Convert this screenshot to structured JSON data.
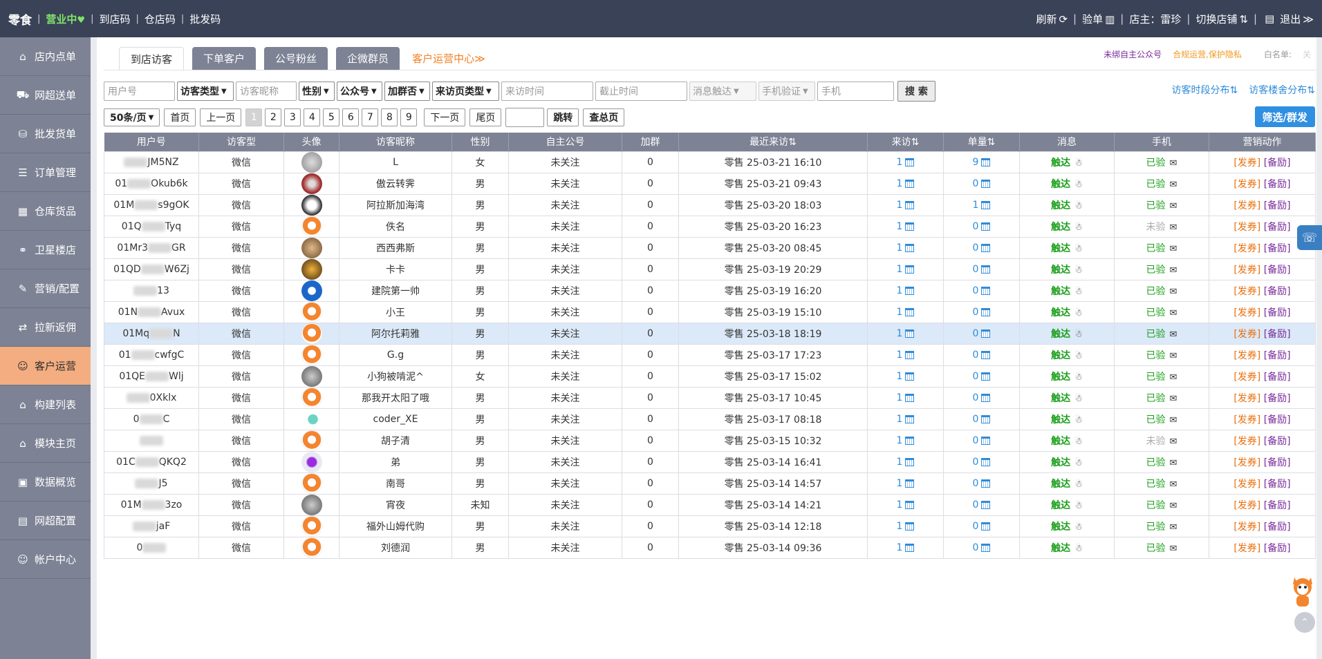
{
  "topbar": {
    "brand": "零食",
    "status": "营业中",
    "links": [
      "到店码",
      "仓店码",
      "批发码"
    ],
    "refresh": "刷新",
    "verify": "验单",
    "owner": "店主：雷珍",
    "switch_store": "切换店铺",
    "logout": "退出"
  },
  "sidebar": {
    "items": [
      {
        "label": "店内点单",
        "icon": "home-icon"
      },
      {
        "label": "网超送单",
        "icon": "delivery-icon"
      },
      {
        "label": "批发货单",
        "icon": "wholesale-icon"
      },
      {
        "label": "订单管理",
        "icon": "order-icon"
      },
      {
        "label": "仓库货品",
        "icon": "warehouse-icon"
      },
      {
        "label": "卫星楼店",
        "icon": "satellite-icon"
      },
      {
        "label": "营销/配置",
        "icon": "marketing-icon"
      },
      {
        "label": "拉新返佣",
        "icon": "commission-icon"
      },
      {
        "label": "客户运营",
        "icon": "customer-icon"
      },
      {
        "label": "构建列表",
        "icon": "build-icon"
      },
      {
        "label": "模块主页",
        "icon": "module-icon"
      },
      {
        "label": "数据概览",
        "icon": "data-icon"
      },
      {
        "label": "网超配置",
        "icon": "config-icon"
      },
      {
        "label": "帐户中心",
        "icon": "account-icon"
      }
    ],
    "active_index": 8
  },
  "tabs": {
    "items": [
      "到店访客",
      "下单客户",
      "公号粉丝",
      "企微群员"
    ],
    "center_link": "客户运营中心≫"
  },
  "notes": {
    "unbound": "未绑自主公众号",
    "compliance": "合规运营,保护隐私",
    "whitelist": "白名单:",
    "whitelist_faint": "关"
  },
  "filters": {
    "user_id_placeholder": "用户号",
    "visitor_type": "访客类型",
    "nickname_placeholder": "访客昵称",
    "gender": "性别",
    "official": "公众号",
    "joined": "加群否",
    "source": "来访页类型",
    "visit_time_placeholder": "来访时间",
    "end_time_placeholder": "截止时间",
    "message_reach": "消息触达",
    "phone_verify": "手机验证",
    "phone_placeholder": "手机",
    "search": "搜 索",
    "dist_time": "访客时段分布⇅",
    "dist_building": "访客楼舍分布⇅"
  },
  "pager": {
    "per_page": "50条/页",
    "first": "首页",
    "prev": "上一页",
    "pages": [
      "1",
      "2",
      "3",
      "4",
      "5",
      "6",
      "7",
      "8",
      "9"
    ],
    "current": "1",
    "next": "下一页",
    "last": "尾页",
    "jump": "跳转",
    "total": "查总页",
    "filter_send": "筛选/群发"
  },
  "table": {
    "headers": [
      "用户号",
      "访客型",
      "头像",
      "访客昵称",
      "性别",
      "自主公号",
      "加群",
      "最近来访⇅",
      "来访⇅",
      "单量⇅",
      "消息",
      "手机",
      "营销动作"
    ],
    "rows": [
      {
        "uid_pre": "",
        "uid_suf": "JM5NZ",
        "type": "微信",
        "avatar": "av-gray",
        "nick": "L",
        "gender": "女",
        "follow": "未关注",
        "group": "0",
        "last": "零售 25-03-21 16:10",
        "visits": "1",
        "orders": "9",
        "msg": "触达",
        "phone": "已验",
        "coupon": "[发券]",
        "reward": "[备励]"
      },
      {
        "uid_pre": "01",
        "uid_suf": "Okub6k",
        "type": "微信",
        "avatar": "av-red",
        "nick": "傲云转霁",
        "gender": "男",
        "follow": "未关注",
        "group": "0",
        "last": "零售 25-03-21 09:43",
        "visits": "1",
        "orders": "0",
        "msg": "触达",
        "phone": "已验",
        "coupon": "[发券]",
        "reward": "[备励]"
      },
      {
        "uid_pre": "01M",
        "uid_suf": "s9gOK",
        "type": "微信",
        "avatar": "av-white",
        "nick": "阿拉斯加海湾",
        "gender": "男",
        "follow": "未关注",
        "group": "0",
        "last": "零售 25-03-20 18:03",
        "visits": "1",
        "orders": "1",
        "msg": "触达",
        "phone": "已验",
        "coupon": "[发券]",
        "reward": "[备励]"
      },
      {
        "uid_pre": "01Q",
        "uid_suf": "Tyq",
        "type": "微信",
        "avatar": "av-fox",
        "nick": "佚名",
        "gender": "男",
        "follow": "未关注",
        "group": "0",
        "last": "零售 25-03-20 16:23",
        "visits": "1",
        "orders": "0",
        "msg": "触达",
        "phone": "未验",
        "coupon": "[发券]",
        "reward": "[备励]"
      },
      {
        "uid_pre": "01Mr3",
        "uid_suf": "GR",
        "type": "微信",
        "avatar": "av-face",
        "nick": "西西弗斯",
        "gender": "男",
        "follow": "未关注",
        "group": "0",
        "last": "零售 25-03-20 08:45",
        "visits": "1",
        "orders": "0",
        "msg": "触达",
        "phone": "已验",
        "coupon": "[发券]",
        "reward": "[备励]"
      },
      {
        "uid_pre": "01QD",
        "uid_suf": "W6Zj",
        "type": "微信",
        "avatar": "av-gold",
        "nick": "卡卡",
        "gender": "男",
        "follow": "未关注",
        "group": "0",
        "last": "零售 25-03-19 20:29",
        "visits": "1",
        "orders": "0",
        "msg": "触达",
        "phone": "已验",
        "coupon": "[发券]",
        "reward": "[备励]"
      },
      {
        "uid_pre": "",
        "uid_suf": "13",
        "type": "微信",
        "avatar": "av-blue",
        "nick": "建院第一帅",
        "gender": "男",
        "follow": "未关注",
        "group": "0",
        "last": "零售 25-03-19 16:20",
        "visits": "1",
        "orders": "0",
        "msg": "触达",
        "phone": "已验",
        "coupon": "[发券]",
        "reward": "[备励]"
      },
      {
        "uid_pre": "01N",
        "uid_suf": "Avux",
        "type": "微信",
        "avatar": "av-fox",
        "nick": "小王",
        "gender": "男",
        "follow": "未关注",
        "group": "0",
        "last": "零售 25-03-19 15:10",
        "visits": "1",
        "orders": "0",
        "msg": "触达",
        "phone": "已验",
        "coupon": "[发券]",
        "reward": "[备励]"
      },
      {
        "uid_pre": "01Mq",
        "uid_suf": "N",
        "type": "微信",
        "avatar": "av-fox",
        "nick": "阿尔托莉雅",
        "gender": "男",
        "follow": "未关注",
        "group": "0",
        "last": "零售 25-03-18 18:19",
        "visits": "1",
        "orders": "0",
        "msg": "触达",
        "phone": "已验",
        "coupon": "[发券]",
        "reward": "[备励]"
      },
      {
        "uid_pre": "01",
        "uid_suf": "cwfgC",
        "type": "微信",
        "avatar": "av-fox",
        "nick": "G.g",
        "gender": "男",
        "follow": "未关注",
        "group": "0",
        "last": "零售 25-03-17 17:23",
        "visits": "1",
        "orders": "0",
        "msg": "触达",
        "phone": "已验",
        "coupon": "[发券]",
        "reward": "[备励]"
      },
      {
        "uid_pre": "01QE",
        "uid_suf": "Wlj",
        "type": "微信",
        "avatar": "av-cat",
        "nick": "小狗被啃泥^",
        "gender": "女",
        "follow": "未关注",
        "group": "0",
        "last": "零售 25-03-17 15:02",
        "visits": "1",
        "orders": "0",
        "msg": "触达",
        "phone": "已验",
        "coupon": "[发券]",
        "reward": "[备励]"
      },
      {
        "uid_pre": "",
        "uid_suf": "0Xklx",
        "type": "微信",
        "avatar": "av-fox",
        "nick": "那我开太阳了哦",
        "gender": "男",
        "follow": "未关注",
        "group": "0",
        "last": "零售 25-03-17 10:45",
        "visits": "1",
        "orders": "0",
        "msg": "触达",
        "phone": "已验",
        "coupon": "[发券]",
        "reward": "[备励]"
      },
      {
        "uid_pre": "0",
        "uid_suf": "C",
        "type": "微信",
        "avatar": "av-teal",
        "nick": "coder_XE",
        "gender": "男",
        "follow": "未关注",
        "group": "0",
        "last": "零售 25-03-17 08:18",
        "visits": "1",
        "orders": "0",
        "msg": "触达",
        "phone": "已验",
        "coupon": "[发券]",
        "reward": "[备励]"
      },
      {
        "uid_pre": "",
        "uid_suf": "",
        "type": "微信",
        "avatar": "av-fox",
        "nick": "胡子清",
        "gender": "男",
        "follow": "未关注",
        "group": "0",
        "last": "零售 25-03-15 10:32",
        "visits": "1",
        "orders": "0",
        "msg": "触达",
        "phone": "未验",
        "coupon": "[发券]",
        "reward": "[备励]"
      },
      {
        "uid_pre": "01C",
        "uid_suf": "QKQ2",
        "type": "微信",
        "avatar": "av-purple",
        "nick": "弟",
        "gender": "男",
        "follow": "未关注",
        "group": "0",
        "last": "零售 25-03-14 16:41",
        "visits": "1",
        "orders": "0",
        "msg": "触达",
        "phone": "已验",
        "coupon": "[发券]",
        "reward": "[备励]"
      },
      {
        "uid_pre": "",
        "uid_suf": "J5",
        "type": "微信",
        "avatar": "av-fox",
        "nick": "南哥",
        "gender": "男",
        "follow": "未关注",
        "group": "0",
        "last": "零售 25-03-14 14:57",
        "visits": "1",
        "orders": "0",
        "msg": "触达",
        "phone": "已验",
        "coupon": "[发券]",
        "reward": "[备励]"
      },
      {
        "uid_pre": "01M",
        "uid_suf": "3zo",
        "type": "微信",
        "avatar": "av-cat",
        "nick": "宵夜",
        "gender": "未知",
        "follow": "未关注",
        "group": "0",
        "last": "零售 25-03-14 14:21",
        "visits": "1",
        "orders": "0",
        "msg": "触达",
        "phone": "已验",
        "coupon": "[发券]",
        "reward": "[备励]"
      },
      {
        "uid_pre": "",
        "uid_suf": "jaF",
        "type": "微信",
        "avatar": "av-fox",
        "nick": "福外山姆代购",
        "gender": "男",
        "follow": "未关注",
        "group": "0",
        "last": "零售 25-03-14 12:18",
        "visits": "1",
        "orders": "0",
        "msg": "触达",
        "phone": "已验",
        "coupon": "[发券]",
        "reward": "[备励]"
      },
      {
        "uid_pre": "0",
        "uid_suf": "",
        "type": "微信",
        "avatar": "av-fox",
        "nick": "刘德润",
        "gender": "男",
        "follow": "未关注",
        "group": "0",
        "last": "零售 25-03-14 09:36",
        "visits": "1",
        "orders": "0",
        "msg": "触达",
        "phone": "已验",
        "coupon": "[发券]",
        "reward": "[备励]"
      }
    ],
    "highlight_row": 8
  }
}
